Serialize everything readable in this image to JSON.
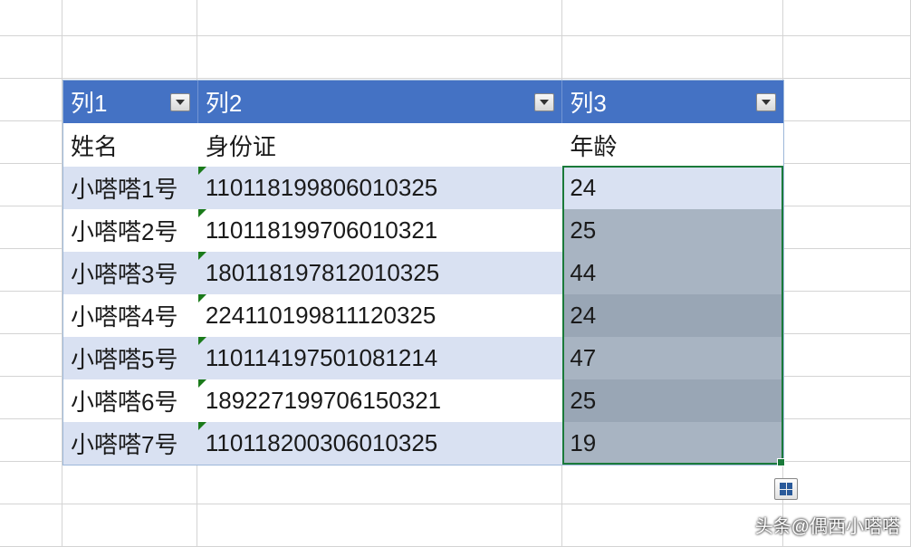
{
  "header_cols": [
    {
      "label": "列1"
    },
    {
      "label": "列2"
    },
    {
      "label": "列3"
    }
  ],
  "subheaders": {
    "col1": "姓名",
    "col2": "身份证",
    "col3": "年龄"
  },
  "rows": [
    {
      "name": "小嗒嗒1号",
      "id": "110118199806010325",
      "age": "24"
    },
    {
      "name": "小嗒嗒2号",
      "id": "110118199706010321",
      "age": "25"
    },
    {
      "name": "小嗒嗒3号",
      "id": "180118197812010325",
      "age": "44"
    },
    {
      "name": "小嗒嗒4号",
      "id": "224110199811120325",
      "age": "24"
    },
    {
      "name": "小嗒嗒5号",
      "id": "110114197501081214",
      "age": "47"
    },
    {
      "name": "小嗒嗒6号",
      "id": "189227199706150321",
      "age": "25"
    },
    {
      "name": "小嗒嗒7号",
      "id": "110118200306010325",
      "age": "19"
    }
  ],
  "watermark": "头条@偶西小嗒嗒"
}
